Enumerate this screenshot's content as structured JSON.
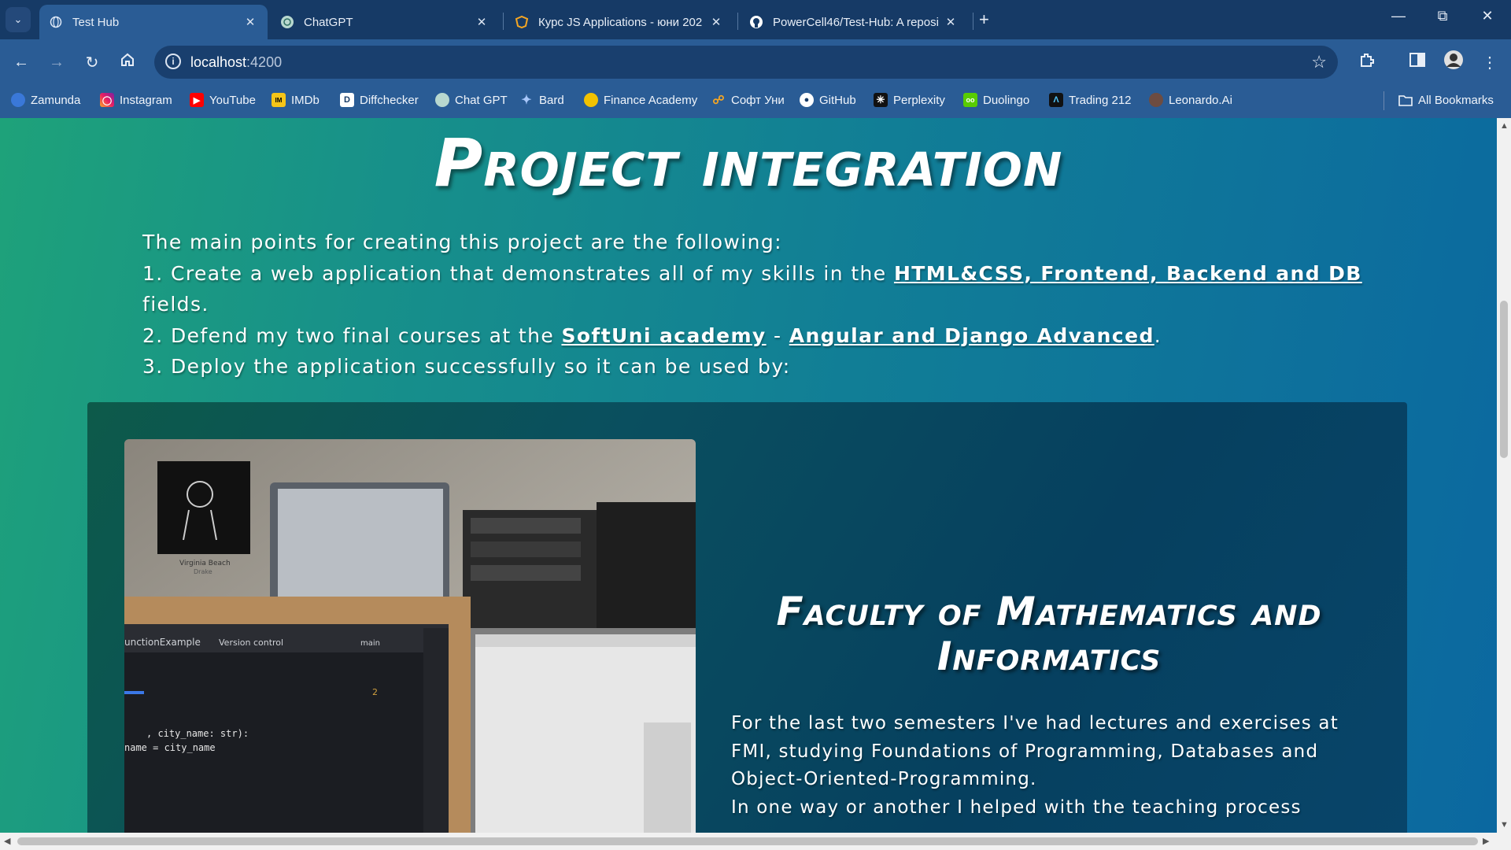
{
  "tabs": [
    {
      "label": "Test Hub",
      "active": true,
      "icon": "globe-icon"
    },
    {
      "label": "ChatGPT",
      "active": false,
      "icon": "chatgpt-icon"
    },
    {
      "label": "Курс JS Applications - юни 202",
      "active": false,
      "icon": "softuni-icon"
    },
    {
      "label": "PowerCell46/Test-Hub: A reposi",
      "active": false,
      "icon": "github-icon"
    }
  ],
  "address_bar": {
    "host": "localhost",
    "port": ":4200"
  },
  "bookmarks": [
    {
      "label": "Zamunda",
      "icon": "zamunda-icon"
    },
    {
      "label": "Instagram",
      "icon": "instagram-icon"
    },
    {
      "label": "YouTube",
      "icon": "youtube-icon"
    },
    {
      "label": "IMDb",
      "icon": "imdb-icon"
    },
    {
      "label": "Diffchecker",
      "icon": "diffchecker-icon"
    },
    {
      "label": "Chat GPT",
      "icon": "chatgpt-icon"
    },
    {
      "label": "Bard",
      "icon": "bard-icon"
    },
    {
      "label": "Finance Academy",
      "icon": "finance-icon"
    },
    {
      "label": "Софт Уни",
      "icon": "softuni-icon"
    },
    {
      "label": "GitHub",
      "icon": "github-icon"
    },
    {
      "label": "Perplexity",
      "icon": "perplexity-icon"
    },
    {
      "label": "Duolingo",
      "icon": "duolingo-icon"
    },
    {
      "label": "Trading 212",
      "icon": "trading212-icon"
    },
    {
      "label": "Leonardo.Ai",
      "icon": "leonardo-icon"
    }
  ],
  "all_bookmarks_label": "All Bookmarks",
  "page": {
    "title": "Project integration",
    "intro_line0": "The main points for creating this project are the following:",
    "intro_line1_pre": "1. Create a web application that demonstrates all of my skills in the ",
    "intro_line1_link": "HTML&CSS, Frontend, Backend and DB",
    "intro_line1_post": " fields.",
    "intro_line2_pre": "2. Defend my two final courses at the ",
    "intro_line2_link1": "SoftUni academy",
    "intro_line2_mid": " - ",
    "intro_line2_link2": "Angular and Django Advanced",
    "intro_line2_post": ".",
    "intro_line3": "3. Deploy the application successfully so it can be used by:",
    "card": {
      "title": "Faculty of Mathematics and Informatics",
      "text_line1": "For the last two semesters I've had lectures and exercises at FMI, studying Foundations of Programming, Databases and Object-Oriented-Programming.",
      "text_line2": "In one way or another I helped with the teaching process",
      "photo": {
        "music_title": "Virginia Beach",
        "music_artist": "Drake",
        "ide_project": "unctionExample",
        "ide_vcs": "Version control",
        "ide_branch": "main",
        "ide_warnings": "2",
        "code_line1": ", city_name: str):",
        "code_line2": "name = city_name"
      }
    }
  },
  "colors": {
    "tabstrip": "#163a66",
    "toolbar": "#2a5c95",
    "page_gradient_start": "#1ea27a",
    "page_gradient_end": "#0b68a0",
    "card_bg": "#06405f"
  }
}
